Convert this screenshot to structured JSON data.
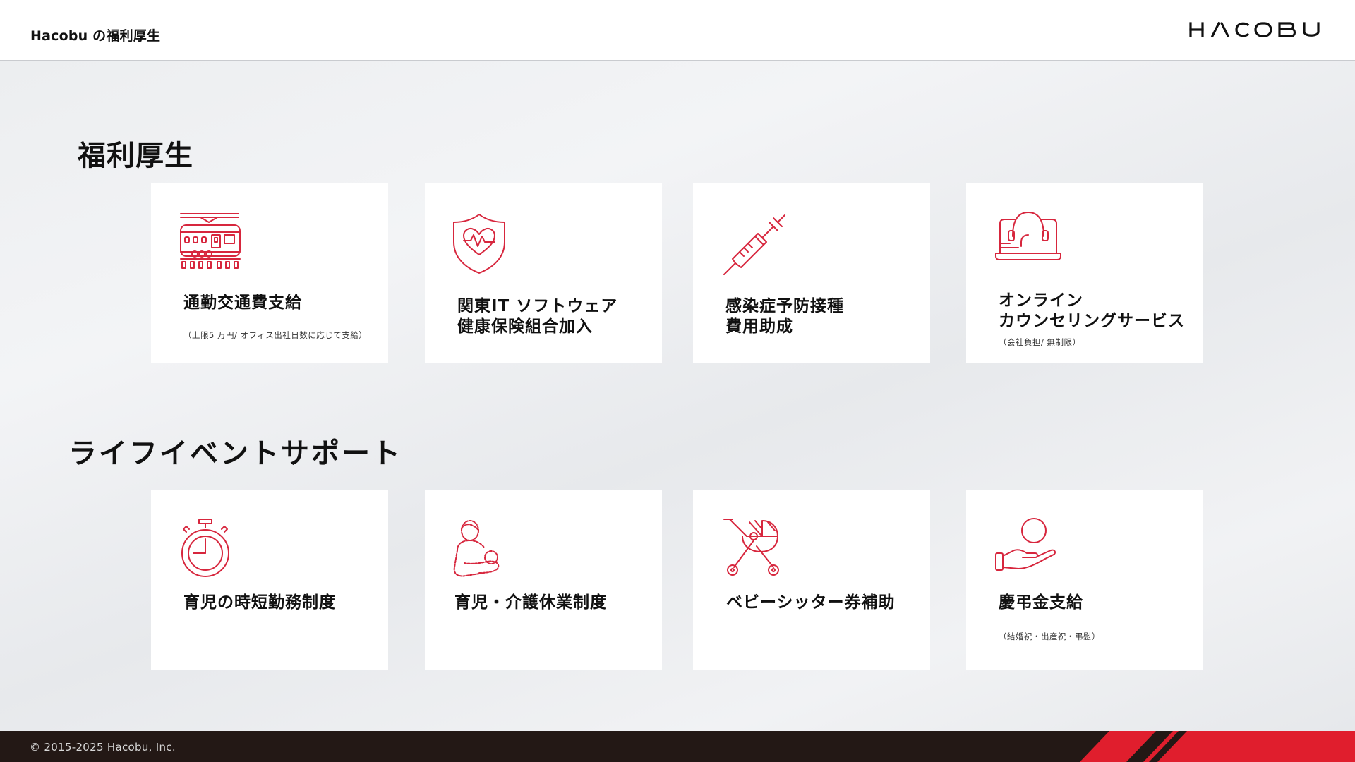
{
  "header": {
    "title": "Hacobu の福利厚生",
    "logo_text": "HACOBU"
  },
  "sections": [
    {
      "title": "福利厚生",
      "cards": [
        {
          "icon": "train-icon",
          "title_lines": [
            "通勤交通費支給"
          ],
          "note": "（上限5 万円/ オフィス出社日数に応じて支給）"
        },
        {
          "icon": "health-shield-icon",
          "title_lines": [
            "関東IT ソフトウェア",
            "健康保険組合加入"
          ],
          "note": ""
        },
        {
          "icon": "syringe-icon",
          "title_lines": [
            "感染症予防接種",
            "費用助成"
          ],
          "note": ""
        },
        {
          "icon": "online-counseling-icon",
          "title_lines": [
            "オンライン",
            "カウンセリングサービス"
          ],
          "note": "（会社負担/ 無制限）"
        }
      ]
    },
    {
      "title": "ライフイベントサポート",
      "cards": [
        {
          "icon": "stopwatch-icon",
          "title_lines": [
            "育児の時短勤務制度"
          ],
          "note": ""
        },
        {
          "icon": "parent-child-icon",
          "title_lines": [
            "育児・介護休業制度"
          ],
          "note": ""
        },
        {
          "icon": "baby-stroller-icon",
          "title_lines": [
            "ベビーシッター券補助"
          ],
          "note": ""
        },
        {
          "icon": "hand-coin-icon",
          "title_lines": [
            "慶弔金支給"
          ],
          "note": "（結婚祝・出産祝・弔慰）"
        }
      ]
    }
  ],
  "footer": {
    "copyright": "© 2015-2025 Hacobu, Inc."
  },
  "colors": {
    "accent": "#d7263d",
    "footer_bg": "#231815",
    "card_bg": "#ffffff",
    "slide_bg": "#ebecee"
  }
}
